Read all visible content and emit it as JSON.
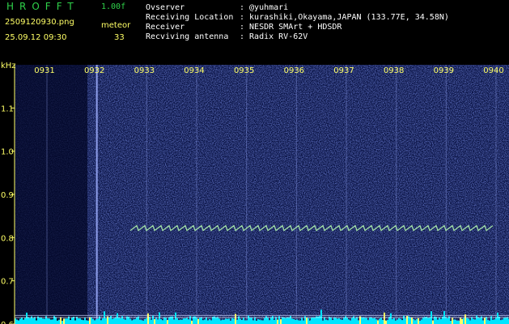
{
  "header": {
    "app_title": "HROFFT",
    "version": "1.00f",
    "filename": "2509120930.png",
    "datetime": "25.09.12 09:30",
    "mode_label": "meteor",
    "count": "33"
  },
  "info": {
    "rows": [
      {
        "label": "Ovserver",
        "value": ": @yuhmari"
      },
      {
        "label": "Receiving Location",
        "value": ": kurashiki,Okayama,JAPAN (133.77E, 34.58N)"
      },
      {
        "label": "Receiver",
        "value": ": NESDR SMArt + HDSDR"
      },
      {
        "label": "Recviving antenna",
        "value": ": Radix RV-62V"
      }
    ]
  },
  "colors": {
    "background": "#000000",
    "spectrogram": "#0a1650",
    "time_label": "#ffff66",
    "freq_label": "#ffff66",
    "echo": "#b8ffb0",
    "noise_floor": "#00e5ff"
  },
  "chart_data": {
    "type": "heatmap",
    "ylabel": "kHz",
    "ylim": [
      0.6,
      1.2
    ],
    "y_ticks": [
      "1.1",
      "1.0",
      "0.9",
      "0.8",
      "0.7",
      "0.6"
    ],
    "y_tick_values": [
      1.1,
      1.0,
      0.9,
      0.8,
      0.7,
      0.6
    ],
    "time_range": [
      "09:30",
      "09:40"
    ],
    "time_ticks": [
      "0931",
      "0932",
      "0933",
      "0934",
      "0935",
      "0936",
      "0937",
      "0938",
      "0939",
      "0940"
    ],
    "time_tick_minutes": [
      1,
      2,
      3,
      4,
      5,
      6,
      7,
      8,
      9,
      10
    ],
    "reference_lines_khz": [
      0.62,
      0.605
    ],
    "signal_trace": {
      "start_minute": 2.8,
      "end_minute": 10.0,
      "start_khz": 0.822,
      "end_khz": 0.822
    }
  }
}
